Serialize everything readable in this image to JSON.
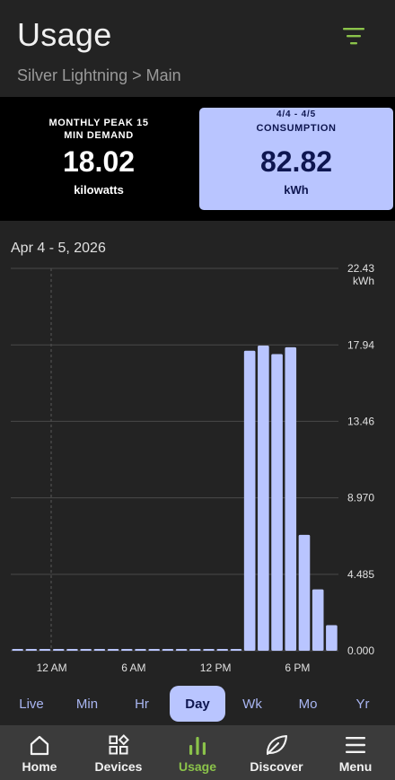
{
  "header": {
    "title": "Usage",
    "breadcrumb": "Silver Lightning > Main",
    "filter_icon": "filter-icon"
  },
  "cards": {
    "peak": {
      "label": "MONTHLY PEAK 15 MIN DEMAND",
      "value": "18.02",
      "unit": "kilowatts"
    },
    "consumption": {
      "range": "4/4 - 4/5",
      "label": "CONSUMPTION",
      "value": "82.82",
      "unit": "kWh"
    }
  },
  "date_range": "Apr 4 - 5, 2026",
  "chart_data": {
    "type": "bar",
    "title": "",
    "ylabel": "kWh",
    "ylim": [
      0,
      22.43
    ],
    "y_ticks": [
      "0.000",
      "4.485",
      "8.970",
      "13.46",
      "17.94",
      "22.43"
    ],
    "y_tick_values": [
      0,
      4.485,
      8.97,
      13.46,
      17.94,
      22.43
    ],
    "x_tick_labels": [
      "12 AM",
      "6 AM",
      "12 PM",
      "6 PM"
    ],
    "x_tick_indices": [
      3,
      9,
      15,
      21
    ],
    "values": [
      0.05,
      0.05,
      0.05,
      0.05,
      0.05,
      0.05,
      0.05,
      0.05,
      0.05,
      0.05,
      0.05,
      0.05,
      0.05,
      0.05,
      0.05,
      0.05,
      0.05,
      17.6,
      17.9,
      17.4,
      17.8,
      6.8,
      3.6,
      1.5
    ],
    "bar_color": "#b9c5ff",
    "grid": true
  },
  "periods": {
    "items": [
      "Live",
      "Min",
      "Hr",
      "Day",
      "Wk",
      "Mo",
      "Yr"
    ],
    "active": "Day"
  },
  "nav": {
    "items": [
      {
        "label": "Home",
        "icon": "home-icon"
      },
      {
        "label": "Devices",
        "icon": "devices-icon"
      },
      {
        "label": "Usage",
        "icon": "usage-icon"
      },
      {
        "label": "Discover",
        "icon": "leaf-icon"
      },
      {
        "label": "Menu",
        "icon": "menu-icon"
      }
    ],
    "active": "Usage"
  },
  "colors": {
    "background": "#232323",
    "accent": "#b9c5ff",
    "nav_active": "#8bc34a"
  }
}
